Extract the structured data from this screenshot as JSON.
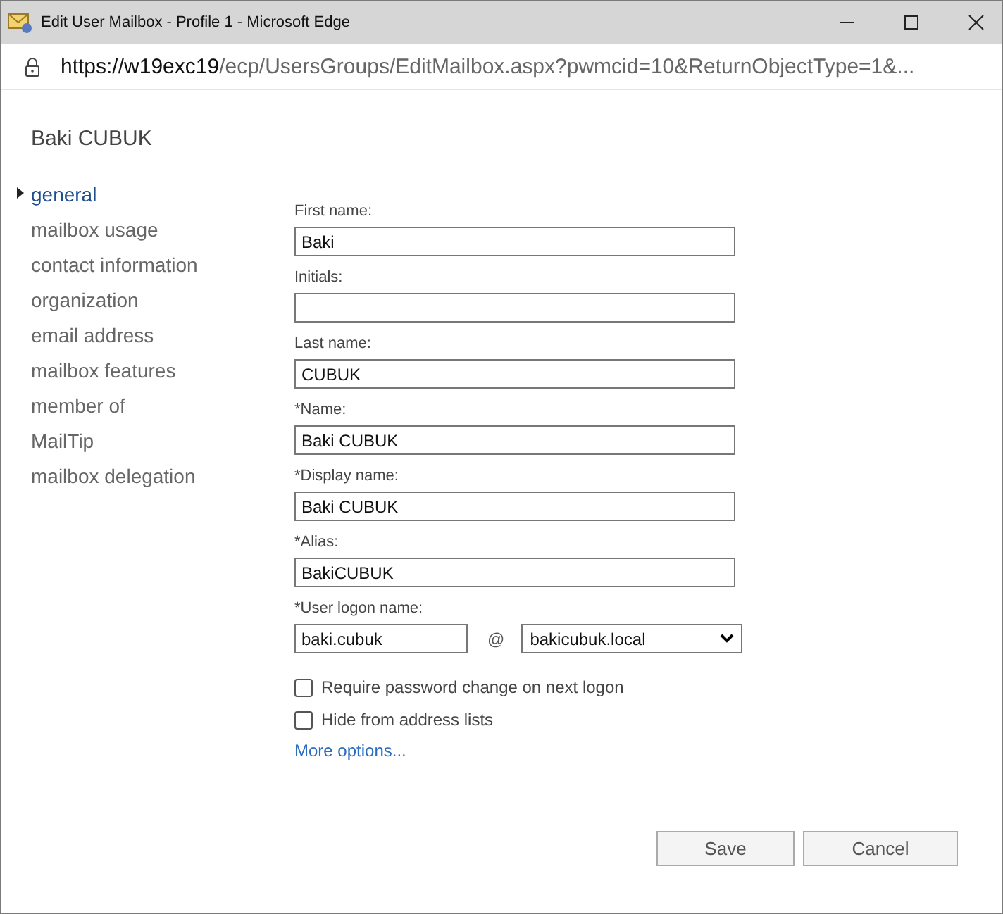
{
  "window": {
    "title": "Edit User Mailbox - Profile 1 - Microsoft Edge",
    "url_host": "https://w19exc19",
    "url_path": "/ecp/UsersGroups/EditMailbox.aspx?pwmcid=10&ReturnObjectType=1&..."
  },
  "heading": "Baki CUBUK",
  "nav": [
    {
      "label": "general",
      "selected": true
    },
    {
      "label": "mailbox usage",
      "selected": false
    },
    {
      "label": "contact information",
      "selected": false
    },
    {
      "label": "organization",
      "selected": false
    },
    {
      "label": "email address",
      "selected": false
    },
    {
      "label": "mailbox features",
      "selected": false
    },
    {
      "label": "member of",
      "selected": false
    },
    {
      "label": "MailTip",
      "selected": false
    },
    {
      "label": "mailbox delegation",
      "selected": false
    }
  ],
  "fields": [
    {
      "label": "First name:",
      "value": "Baki"
    },
    {
      "label": "Initials:"
    },
    {
      "label": "Last name:",
      "value": "CUBUK"
    },
    {
      "label": "*Name:",
      "value": "Baki CUBUK"
    },
    {
      "label": "*Display name:",
      "value": "Baki CUBUK"
    },
    {
      "label": "*Alias:",
      "value": "BakiCUBUK"
    }
  ],
  "logon": {
    "label": "*User logon name:",
    "value": "baki.cubuk",
    "at": "@",
    "domain": "bakicubuk.local"
  },
  "checkboxes": [
    {
      "label": "Require password change on next logon",
      "checked": false
    },
    {
      "label": "Hide from address lists",
      "checked": false
    }
  ],
  "link": "More options...",
  "buttons": [
    "Save",
    "Cancel"
  ]
}
